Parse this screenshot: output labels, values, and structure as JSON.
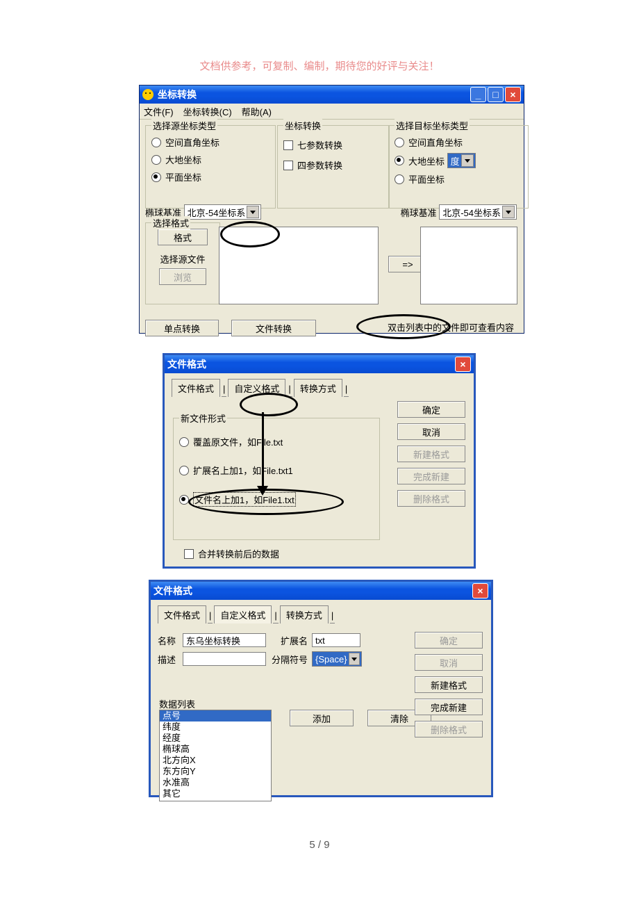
{
  "doc": {
    "header": "文档供参考，可复制、编制，期待您的好评与关注！",
    "footer": "5 / 9"
  },
  "w1": {
    "title": "坐标转换",
    "menu": {
      "file": "文件(F)",
      "conv": "坐标转换(C)",
      "help": "帮助(A)"
    },
    "src": {
      "legend": "选择源坐标类型",
      "o1": "空间直角坐标",
      "o2": "大地坐标",
      "o3": "平面坐标"
    },
    "mid": {
      "legend": "坐标转换",
      "c1": "七参数转换",
      "c2": "四参数转换"
    },
    "dst": {
      "legend": "选择目标坐标类型",
      "o1": "空间直角坐标",
      "o2": "大地坐标",
      "o3": "平面坐标",
      "unit": "度"
    },
    "ell": {
      "label": "椭球基准",
      "value": "北京-54坐标系"
    },
    "fmt": {
      "legend": "选择格式",
      "btn": "格式",
      "srclabel": "选择源文件",
      "browse": "浏览"
    },
    "arrow": "=>",
    "single": "单点转换",
    "fileconv": "文件转换",
    "hint": "双击列表中的文件即可查看内容"
  },
  "w2": {
    "title": "文件格式",
    "tabs": {
      "t1": "文件格式",
      "t2": "自定义格式",
      "t3": "转换方式"
    },
    "new": {
      "legend": "新文件形式",
      "o1": "覆盖原文件，如File.txt",
      "o2": "扩展名上加1，如File.txt1",
      "o3": "文件名上加1，如File1.txt"
    },
    "merge": "合并转换前后的数据",
    "btns": {
      "ok": "确定",
      "cancel": "取消",
      "newf": "新建格式",
      "donen": "完成新建",
      "delf": "删除格式"
    }
  },
  "w3": {
    "title": "文件格式",
    "tabs": {
      "t1": "文件格式",
      "t2": "自定义格式",
      "t3": "转换方式"
    },
    "name": {
      "label": "名称",
      "value": "东乌坐标转换"
    },
    "ext": {
      "label": "扩展名",
      "value": "txt"
    },
    "desc": {
      "label": "描述",
      "value": ""
    },
    "sep": {
      "label": "分隔符号",
      "value": "{Space}"
    },
    "datalabel": "数据列表",
    "items": [
      "点号",
      "纬度",
      "经度",
      "椭球高",
      "北方向X",
      "东方向Y",
      "水准高",
      "其它"
    ],
    "add": "添加",
    "clear": "清除",
    "btns": {
      "ok": "确定",
      "cancel": "取消",
      "newf": "新建格式",
      "donen": "完成新建",
      "delf": "删除格式"
    }
  }
}
